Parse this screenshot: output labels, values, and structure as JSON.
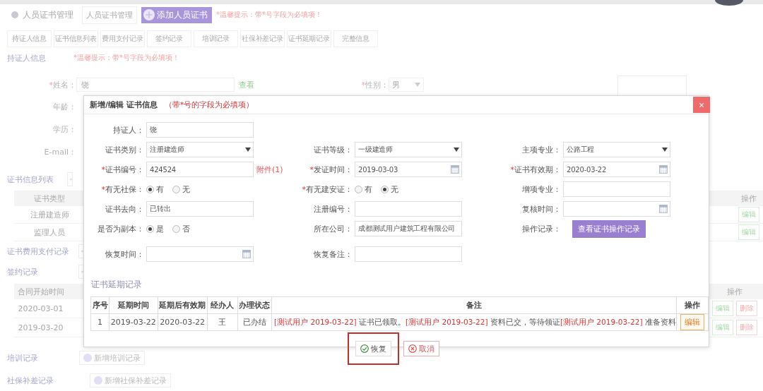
{
  "header": {
    "title": "人员证书管理",
    "crumb_button": "人员证书管理",
    "add_button": "添加人员证书",
    "hint": "*温馨提示：带*号字段为必填项！"
  },
  "tabs": [
    "持证人信息",
    "证书信息列表",
    "费用支付记录",
    "签约记录",
    "培训记录",
    "社保补差记录",
    "证书延期记录",
    "完整信息"
  ],
  "holder": {
    "title": "持证人信息",
    "hint": "*温馨提示：带*号字段为必填项！",
    "name_mark": "*",
    "name_label": "姓名：",
    "name_value": "饶",
    "view_link": "查看",
    "gender_mark": "*",
    "gender_label": "性别：",
    "gender_value": "男",
    "labels": [
      "年龄：",
      "学历：",
      "E-mail："
    ]
  },
  "cert_list": {
    "title": "证书信息列表",
    "columns": [
      "证书类型",
      "操作"
    ],
    "rows": [
      {
        "type": "注册建造师",
        "action": "编辑"
      },
      {
        "type": "监理人员",
        "action": "编辑"
      }
    ]
  },
  "fee_section": {
    "title": "证书费用支付记录"
  },
  "contract": {
    "title": "签约记录",
    "columns": [
      "合同开始时间",
      "操作"
    ],
    "rows": [
      {
        "start": "2020-03-01",
        "actions": [
          "编辑",
          "删除"
        ]
      },
      {
        "start": "2019-03-20",
        "actions": [
          "编辑",
          "删除"
        ]
      }
    ]
  },
  "training": {
    "title": "培训记录",
    "button": "新增培训记录"
  },
  "social": {
    "title": "社保补差记录",
    "button": "新增社保补差记录"
  },
  "modal": {
    "title": "新增/编辑 证书信息",
    "note": "（带*号的字段为必填项）",
    "close": "×",
    "rows": [
      [
        {
          "kind": "text",
          "label": "持证人：",
          "value": "饶"
        }
      ],
      [
        {
          "kind": "select",
          "label": "证书类别：",
          "value": "注册建造师"
        },
        {
          "kind": "select",
          "label": "证书等级：",
          "value": "一级建造师"
        },
        {
          "kind": "select",
          "label": "主项专业：",
          "value": "公路工程"
        }
      ],
      [
        {
          "kind": "text",
          "mark": "*",
          "label": "证书编号：",
          "value": "424524",
          "link": "附件(1)"
        },
        {
          "kind": "date",
          "mark": "*",
          "label": "发证时间：",
          "value": "2019-03-03"
        },
        {
          "kind": "date",
          "mark": "*",
          "label": "证书有效期：",
          "value": "2020-03-22"
        }
      ],
      [
        {
          "kind": "radio",
          "mark": "*",
          "label": "有无社保：",
          "options": [
            {
              "label": "有",
              "selected": true
            },
            {
              "label": "无",
              "selected": false
            }
          ]
        },
        {
          "kind": "radio",
          "mark": "*",
          "label": "有无建安证：",
          "options": [
            {
              "label": "有",
              "selected": false
            },
            {
              "label": "无",
              "selected": true
            }
          ]
        },
        {
          "kind": "text",
          "label": "增项专业："
        }
      ],
      [
        {
          "kind": "text",
          "label": "证书去向：",
          "value": "已转出"
        },
        {
          "kind": "text",
          "label": "注册编号："
        },
        {
          "kind": "date",
          "label": "复核时间："
        }
      ],
      [
        {
          "kind": "radio",
          "label": "是否为副本：",
          "options": [
            {
              "label": "是",
              "selected": true
            },
            {
              "label": "否",
              "selected": false
            }
          ]
        },
        {
          "kind": "text",
          "label": "所在公司：",
          "value": "成都测试用户建筑工程有限公司"
        },
        {
          "kind": "button",
          "label": "操作记录：",
          "button": "查看证书操作记录"
        }
      ],
      [
        {
          "kind": "date",
          "label": "恢复时间："
        },
        {
          "kind": "text",
          "label": "恢复备注："
        }
      ]
    ],
    "extension": {
      "title": "证书延期记录",
      "columns": [
        "序号",
        "延期时间",
        "延期后有效期",
        "经办人",
        "办理状态",
        "备注",
        "操作"
      ],
      "rows": [
        {
          "cells": [
            "1",
            "2019-03-22",
            "2020-03-22",
            "王",
            "已办结"
          ],
          "remark": [
            {
              "user": "[测试用户 2019-03-22]",
              "text": " 证书已领取。"
            },
            {
              "user": "[测试用户 2019-03-22]",
              "text": " 资料已交，等待领证"
            },
            {
              "user": "[测试用户 2019-03-22]",
              "text": " 准备资料"
            }
          ],
          "action": "编辑"
        }
      ]
    },
    "buttons": [
      {
        "kind": "confirm",
        "label": "恢复",
        "highlighted": true
      },
      {
        "kind": "cancel",
        "label": "取消",
        "highlighted": false
      }
    ]
  }
}
